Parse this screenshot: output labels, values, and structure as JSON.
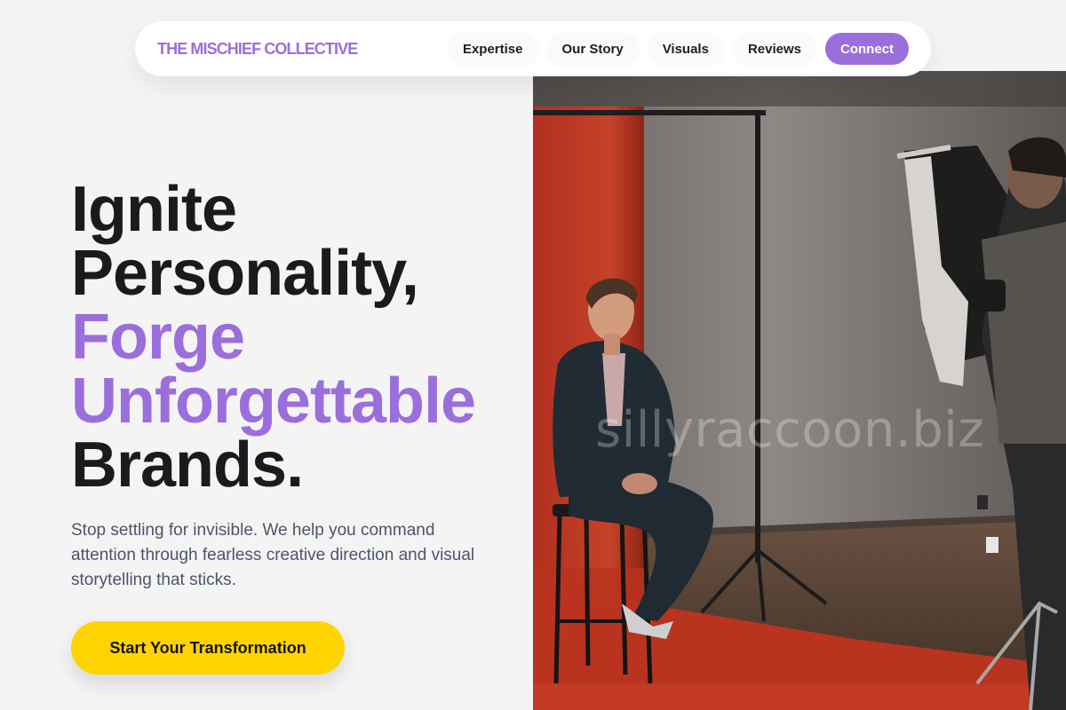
{
  "nav": {
    "brand": "THE MISCHIEF COLLECTIVE",
    "links": [
      {
        "label": "Expertise"
      },
      {
        "label": "Our Story"
      },
      {
        "label": "Visuals"
      },
      {
        "label": "Reviews"
      }
    ],
    "cta_label": "Connect"
  },
  "hero": {
    "headline_lines": [
      "Ignite",
      "Personality,",
      "Forge",
      "Unforgettable",
      "Brands."
    ],
    "subcopy": "Stop settling for invisible. We help you command attention through fearless creative direction and visual storytelling that sticks.",
    "cta_label": "Start Your Transformation"
  },
  "photo": {
    "watermark": "sillyraccoon.biz"
  },
  "colors": {
    "background": "#f4f4f5",
    "accent_purple": "#9b6fdb",
    "cta_yellow": "#ffd400",
    "text_dark": "#1b1b1b",
    "text_muted": "#4d5566"
  }
}
